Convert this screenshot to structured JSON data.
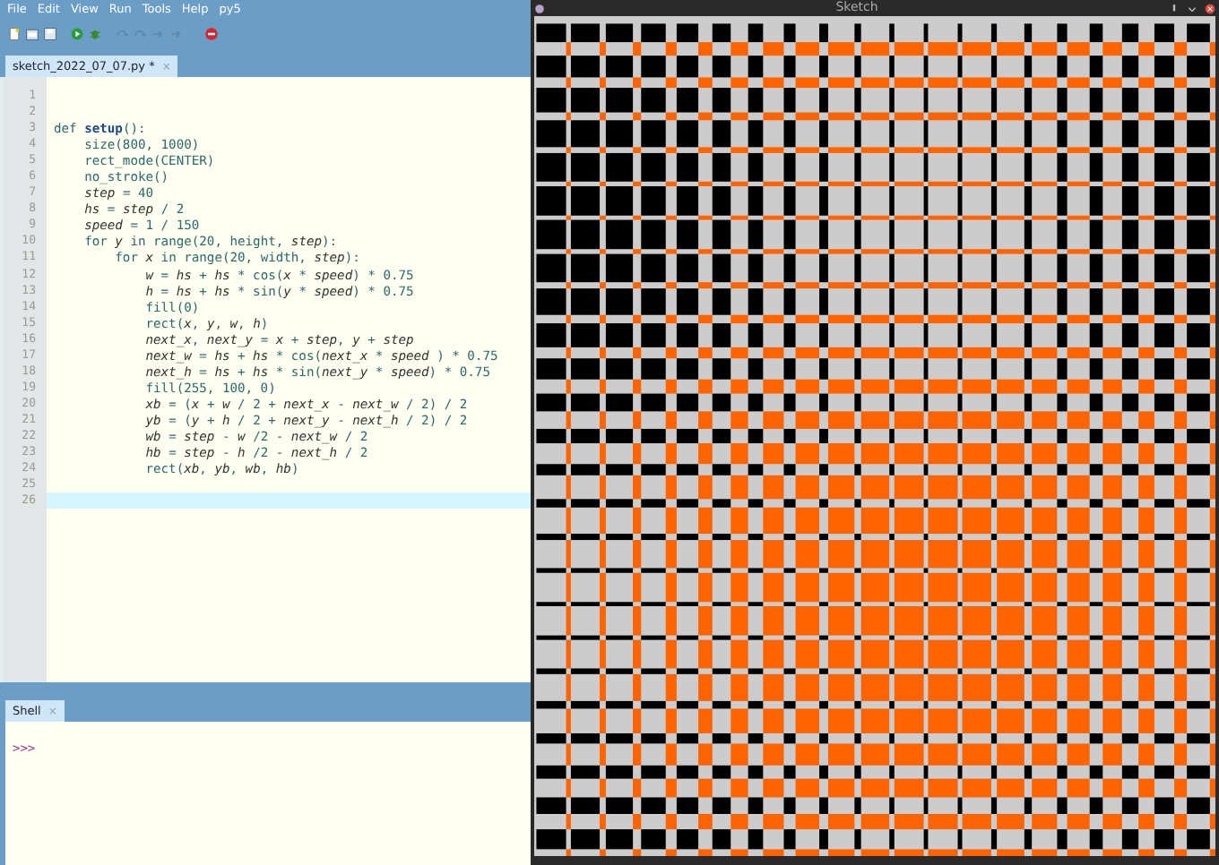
{
  "menu": [
    "File",
    "Edit",
    "View",
    "Run",
    "Tools",
    "Help",
    "py5"
  ],
  "toolbar": [
    {
      "kind": "new",
      "disabled": false
    },
    {
      "kind": "open",
      "disabled": false
    },
    {
      "kind": "save",
      "disabled": false
    },
    {
      "kind": "run",
      "disabled": false
    },
    {
      "kind": "debug",
      "disabled": false
    },
    {
      "kind": "undo",
      "disabled": true
    },
    {
      "kind": "redo",
      "disabled": true
    },
    {
      "kind": "step",
      "disabled": true
    },
    {
      "kind": "resume",
      "disabled": true
    },
    {
      "kind": "stop",
      "disabled": false
    }
  ],
  "editor_tab": {
    "label": "sketch_2022_07_07.py *",
    "close": "×"
  },
  "lines": [
    {
      "number": "1",
      "current": false
    },
    {
      "number": "2",
      "current": false
    },
    {
      "number": "3",
      "code": "def **setup**():",
      "current": false
    },
    {
      "number": "4",
      "code": "    size(800, 1000)",
      "current": false
    },
    {
      "number": "5",
      "code": "    rect_mode(CENTER)",
      "current": false
    },
    {
      "number": "6",
      "code": "    no_stroke()",
      "current": false
    },
    {
      "number": "7",
      "code": "    *step* = 40",
      "current": false
    },
    {
      "number": "8",
      "code": "    *hs* = *step* / 2",
      "current": false
    },
    {
      "number": "9",
      "code": "    *speed* = 1 / 150",
      "current": false
    },
    {
      "number": "10",
      "code": "    for *y* in range(20, height, *step*):",
      "current": false
    },
    {
      "number": "11",
      "code": "        for *x* in range(20, width, *step*):",
      "current": false
    },
    {
      "number": "12",
      "code": "            *w* = *hs* + *hs* * cos(*x* * *speed*) * 0.75",
      "current": false
    },
    {
      "number": "13",
      "code": "            *h* = *hs* + *hs* * sin(*y* * *speed*) * 0.75",
      "current": false
    },
    {
      "number": "14",
      "code": "            fill(0)",
      "current": false
    },
    {
      "number": "15",
      "code": "            rect(*x*, *y*, *w*, *h*)",
      "current": false
    },
    {
      "number": "16",
      "code": "            *next_x*, *next_y* = *x* + *step*, *y* + *step*",
      "current": false
    },
    {
      "number": "17",
      "code": "            *next_w* = *hs* + *hs* * cos(*next_x* * *speed* ) * 0.75",
      "current": false
    },
    {
      "number": "18",
      "code": "            *next_h* = *hs* + *hs* * sin(*next_y* * *speed*) * 0.75",
      "current": false
    },
    {
      "number": "19",
      "code": "            fill(255, 100, 0)",
      "current": false
    },
    {
      "number": "20",
      "code": "            *xb* = (*x* + *w* / 2 + *next_x* - *next_w* / 2) / 2",
      "current": false
    },
    {
      "number": "21",
      "code": "            *yb* = (*y* + *h* / 2 + *next_y* - *next_h* / 2) / 2",
      "current": false
    },
    {
      "number": "22",
      "code": "            *wb* = *step* - *w* /2 - *next_w* / 2",
      "current": false
    },
    {
      "number": "23",
      "code": "            *hb* = *step* - *h* /2 - *next_h* / 2",
      "current": false
    },
    {
      "number": "24",
      "code": "            rect(*xb*, *yb*, *wb*, *hb*)",
      "current": false
    },
    {
      "number": "25",
      "current": false
    },
    {
      "number": "26",
      "current": true
    }
  ],
  "shell": {
    "tab": "Shell",
    "close": "×",
    "prompt": ">>>"
  },
  "sketch_window": {
    "title": "Sketch"
  }
}
